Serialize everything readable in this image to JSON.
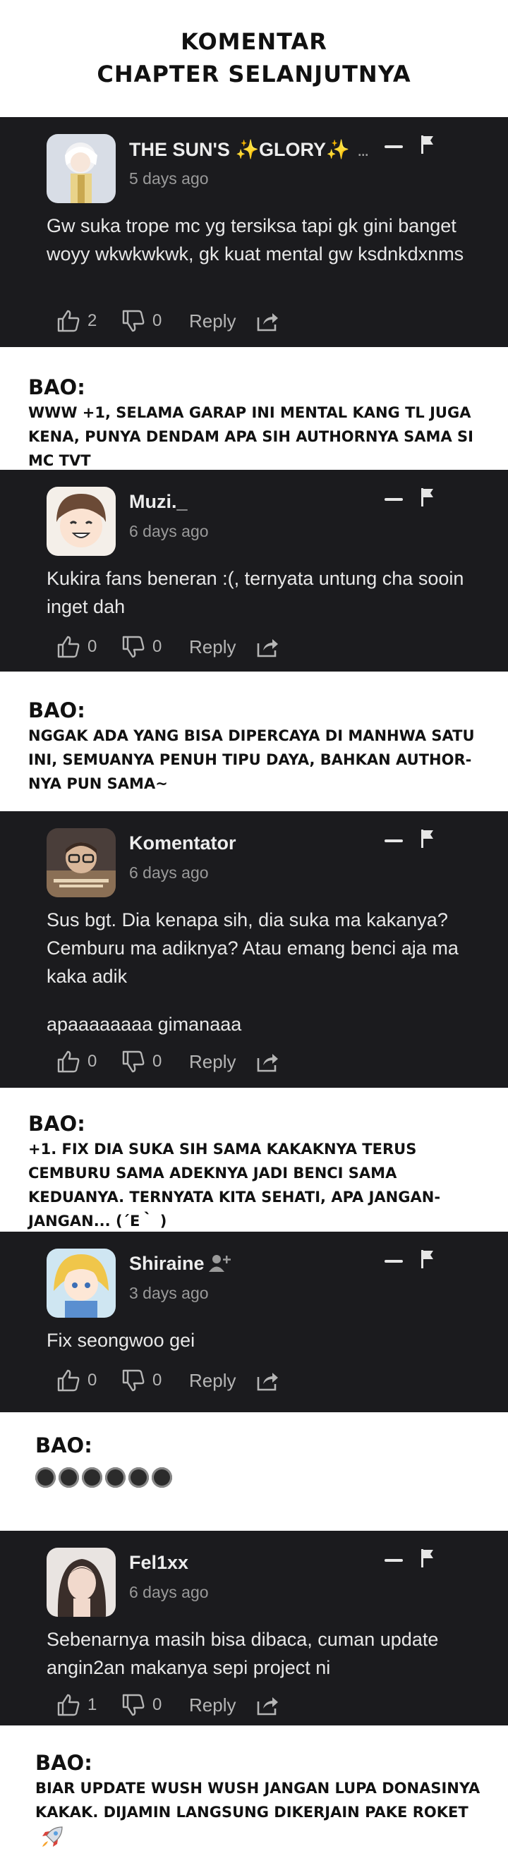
{
  "header": {
    "line1": "KOMENTAR",
    "line2": "CHAPTER SELANJUTNYA"
  },
  "comments": [
    {
      "username": "THE SUN'S ✨GLORY✨",
      "suffix": "...",
      "time_ago": "5 days ago",
      "paragraphs": [
        "Gw suka trope mc yg tersiksa tapi gk gini banget woyy wkwkwkwk, gk kuat mental gw ksdnkdxnms"
      ],
      "likes": "2",
      "dislikes": "0",
      "reply_label": "Reply",
      "avatar_icon": "anime-avatar-white-hair"
    },
    {
      "username": "Muzi._",
      "time_ago": "6 days ago",
      "paragraphs": [
        "Kukira fans beneran :(, ternyata untung cha sooin inget dah"
      ],
      "likes": "0",
      "dislikes": "0",
      "reply_label": "Reply",
      "avatar_icon": "anime-avatar-smiling-boy"
    },
    {
      "username": "Komentator",
      "time_ago": "6 days ago",
      "paragraphs": [
        "Sus bgt. Dia kenapa sih, dia suka ma kakanya? Cemburu ma adiknya? Atau emang benci aja ma kaka adik",
        "apaaaaaaaa gimanaaa"
      ],
      "likes": "0",
      "dislikes": "0",
      "reply_label": "Reply",
      "avatar_icon": "avatar-glasses-man"
    },
    {
      "username": "Shiraine",
      "time_ago": "3 days ago",
      "paragraphs": [
        "Fix seongwoo gei"
      ],
      "likes": "0",
      "dislikes": "0",
      "reply_label": "Reply",
      "avatar_icon": "anime-avatar-blonde-girl"
    },
    {
      "username": "Fel1xx",
      "time_ago": "6 days ago",
      "paragraphs": [
        "Sebenarnya masih bisa dibaca, cuman update angin2an makanya sepi project ni"
      ],
      "likes": "1",
      "dislikes": "0",
      "reply_label": "Reply",
      "avatar_icon": "photo-avatar-girl"
    }
  ],
  "notes": [
    {
      "who": "BAO:",
      "text": "WWW +1, SELAMA GARAP INI MENTAL KANG TL JUGA KENA, PUNYA DENDAM APA SIH AUTHORNYA SAMA SI MC TVT"
    },
    {
      "who": "BAO:",
      "text": "NGGAK ADA YANG BISA DIPERCAYA DI MANHWA SATU INI, SEMUANYA PENUH TIPU DAYA, BAHKAN AUTHOR-NYA PUN SAMA~"
    },
    {
      "who": "BAO:",
      "text": "+1. FIX DIA SUKA SIH SAMA KAKAKNYA TERUS CEMBURU SAMA ADEKNYA JADI BENCI SAMA KEDUANYA. TERNYATA KITA SEHATI, APA JANGAN-JANGAN... (´ε｀ )"
    },
    {
      "who": "BAO:",
      "text": "",
      "emoji_icon": "eyes-emoji"
    },
    {
      "who": "BAO:",
      "text": "BIAR UPDATE WUSH WUSH JANGAN LUPA DONASINYA KAKAK. DIJAMIN LANGSUNG DIKERJAIN PAKE ROKET",
      "emoji_icon": "rocket-emoji"
    }
  ]
}
